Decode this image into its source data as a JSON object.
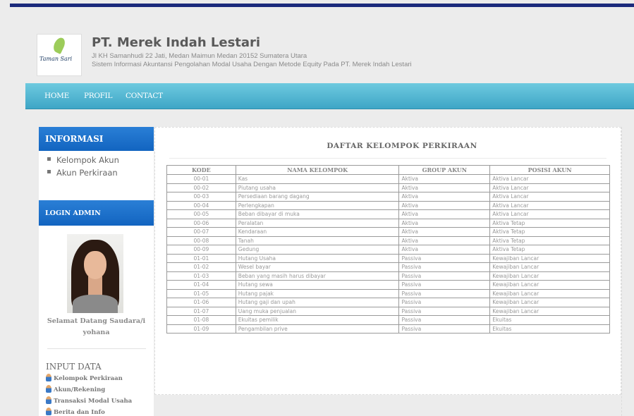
{
  "header": {
    "logo": {
      "script_text": "Taman Sari",
      "icon": "leaf-logo-icon"
    },
    "company_name": "PT. Merek Indah Lestari",
    "address": "Jl KH Samanhudi 22 Jati, Medan Maimun Medan 20152 Sumatera Utara",
    "description": "Sistem Informasi Akuntansi Pengolahan Modal Usaha Dengan Metode Equity Pada PT. Merek Indah Lestari"
  },
  "nav": {
    "items": [
      "HOME",
      "PROFIL",
      "CONTACT"
    ]
  },
  "sidebar": {
    "informasi_title": "INFORMASI",
    "informasi_links": [
      "Kelompok Akun",
      "Akun Perkiraan"
    ],
    "login_title": "LOGIN ADMIN",
    "welcome_line1": "Selamat Datang Saudara/i",
    "welcome_line2": "yohana",
    "input_title": "INPUT DATA",
    "input_links": [
      "Kelompok Perkiraan",
      "Akun/Rekening",
      "Transaksi Modal Usaha",
      "Berita dan Info"
    ]
  },
  "main": {
    "title": "DAFTAR KELOMPOK PERKIRAAN",
    "columns": [
      "KODE",
      "NAMA KELOMPOK",
      "GROUP AKUN",
      "POSISI AKUN"
    ],
    "rows": [
      [
        "00-01",
        "Kas",
        "Aktiva",
        "Aktiva Lancar"
      ],
      [
        "00-02",
        "Piutang usaha",
        "Aktiva",
        "Aktiva Lancar"
      ],
      [
        "00-03",
        "Persediaan barang dagang",
        "Aktiva",
        "Aktiva Lancar"
      ],
      [
        "00-04",
        "Perlengkapan",
        "Aktiva",
        "Aktiva Lancar"
      ],
      [
        "00-05",
        "Beban dibayar di muka",
        "Aktiva",
        "Aktiva Lancar"
      ],
      [
        "00-06",
        "Peralatan",
        "Aktiva",
        "Aktiva Tetap"
      ],
      [
        "00-07",
        "Kendaraan",
        "Aktiva",
        "Aktiva Tetap"
      ],
      [
        "00-08",
        "Tanah",
        "Aktiva",
        "Aktiva Tetap"
      ],
      [
        "00-09",
        "Gedung",
        "Aktiva",
        "Aktiva Tetap"
      ],
      [
        "01-01",
        "Hutang Usaha",
        "Passiva",
        "Kewajiban Lancar"
      ],
      [
        "01-02",
        "Wesel bayar",
        "Passiva",
        "Kewajiban Lancar"
      ],
      [
        "01-03",
        "Beban yang masih harus dibayar",
        "Passiva",
        "Kewajiban Lancar"
      ],
      [
        "01-04",
        "Hutang sewa",
        "Passiva",
        "Kewajiban Lancar"
      ],
      [
        "01-05",
        "Hutang pajak",
        "Passiva",
        "Kewajiban Lancar"
      ],
      [
        "01-06",
        "Hutang gaji dan upah",
        "Passiva",
        "Kewajiban Lancar"
      ],
      [
        "01-07",
        "Uang muka penjualan",
        "Passiva",
        "Kewajiban Lancar"
      ],
      [
        "01-08",
        "Ekuitas pemilik",
        "Passiva",
        "Ekuitas"
      ],
      [
        "01-09",
        "Pengambilan prive",
        "Passiva",
        "Ekuitas"
      ]
    ]
  },
  "colors": {
    "top_bar": "#1c2a7c",
    "nav": "#4fb5d3",
    "side_head": "#1b6fcb"
  }
}
